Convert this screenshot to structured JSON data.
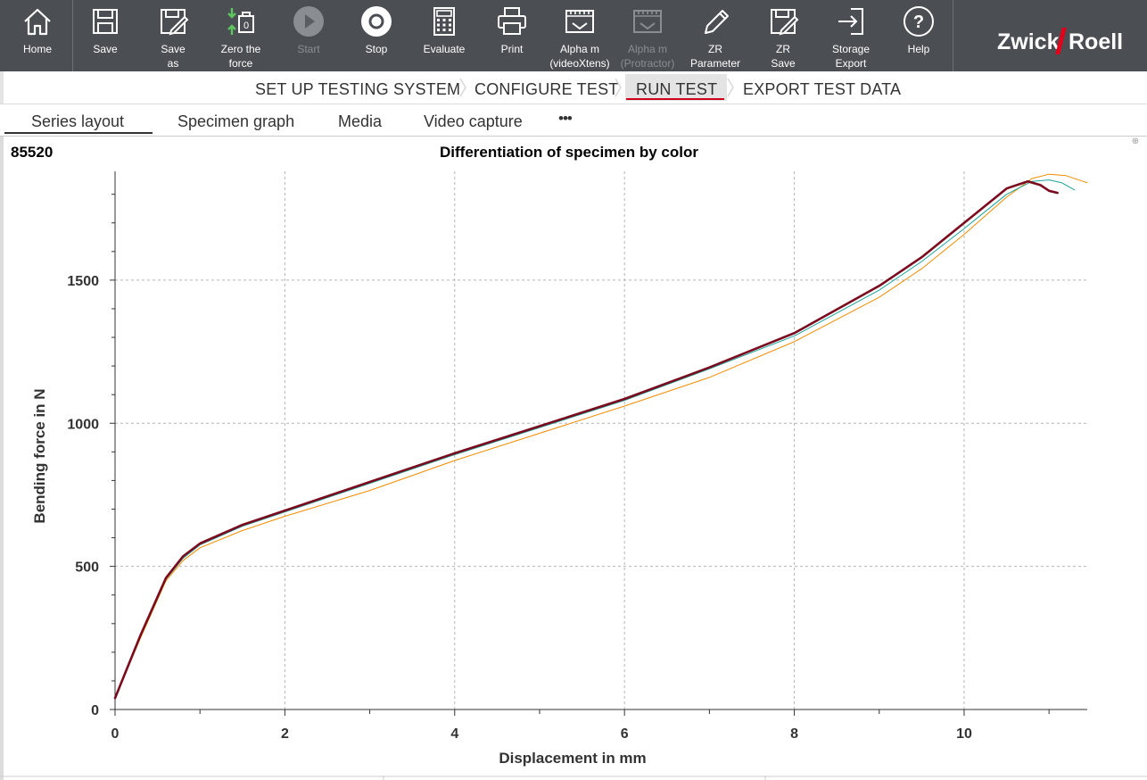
{
  "toolbar": {
    "buttons": [
      {
        "label": "Home",
        "icon": "home-icon",
        "enabled": true
      },
      {
        "label": "Save",
        "icon": "save-icon",
        "enabled": true
      },
      {
        "label": "Save\nas",
        "icon": "save-as-icon",
        "enabled": true
      },
      {
        "label": "Zero the\nforce",
        "icon": "zero-force-icon",
        "enabled": true
      },
      {
        "label": "Start",
        "icon": "play-icon",
        "enabled": false
      },
      {
        "label": "Stop",
        "icon": "stop-icon",
        "enabled": true
      },
      {
        "label": "Evaluate",
        "icon": "calculator-icon",
        "enabled": true
      },
      {
        "label": "Print",
        "icon": "printer-icon",
        "enabled": true
      },
      {
        "label": "Alpha m\n(videoXtens)",
        "icon": "ruler-icon",
        "enabled": true
      },
      {
        "label": "Alpha m\n(Protractor)",
        "icon": "ruler-icon",
        "enabled": false
      },
      {
        "label": "ZR\nParameter",
        "icon": "pencil-icon",
        "enabled": true
      },
      {
        "label": "ZR\nSave",
        "icon": "save-edit-icon",
        "enabled": true
      },
      {
        "label": "Storage\nExport",
        "icon": "export-icon",
        "enabled": true
      },
      {
        "label": "Help",
        "icon": "help-icon",
        "enabled": true
      }
    ],
    "logo_left": "Zwick",
    "logo_right": "Roell"
  },
  "nav": {
    "steps": [
      "SET UP TESTING SYSTEM",
      "CONFIGURE TEST",
      "RUN TEST",
      "EXPORT TEST DATA"
    ],
    "active": "RUN TEST"
  },
  "tabs": {
    "items": [
      "Series layout",
      "Specimen graph",
      "Media",
      "Video capture"
    ],
    "more": "•••",
    "active": "Series layout"
  },
  "chart": {
    "id_label": "85520",
    "zoom_symbol": "⊕"
  },
  "chart_data": {
    "type": "line",
    "title": "Differentiation of specimen by color",
    "xlabel": "Displacement in mm",
    "ylabel": "Bending force in N",
    "xlim": [
      0,
      11.45
    ],
    "ylim": [
      0,
      1880
    ],
    "xticks": [
      0,
      2,
      4,
      6,
      8,
      10
    ],
    "xtick_labels": [
      "0",
      "2",
      "4",
      "6",
      "8",
      "10"
    ],
    "yticks": [
      0,
      500,
      1000,
      1500
    ],
    "ytick_labels": [
      "0",
      "500",
      "1000",
      "1500"
    ],
    "grid": true,
    "legend": false,
    "series": [
      {
        "color": "#f08c00",
        "width": 1,
        "x": [
          0,
          0.3,
          0.6,
          0.8,
          1.0,
          1.5,
          2,
          3,
          4,
          5,
          6,
          7,
          8,
          9,
          9.5,
          10,
          10.5,
          10.8,
          11.0,
          11.2,
          11.45
        ],
        "y": [
          40,
          250,
          450,
          520,
          565,
          625,
          675,
          765,
          870,
          965,
          1060,
          1160,
          1285,
          1440,
          1540,
          1660,
          1790,
          1855,
          1870,
          1865,
          1840
        ]
      },
      {
        "color": "#1aa39a",
        "width": 1,
        "x": [
          0,
          0.3,
          0.6,
          0.8,
          1.0,
          1.5,
          2,
          3,
          4,
          5,
          6,
          7,
          8,
          9,
          9.5,
          10,
          10.5,
          10.8,
          11.0,
          11.15,
          11.3
        ],
        "y": [
          40,
          255,
          455,
          528,
          575,
          640,
          690,
          790,
          890,
          985,
          1080,
          1190,
          1305,
          1465,
          1565,
          1680,
          1800,
          1845,
          1850,
          1840,
          1815
        ]
      },
      {
        "color": "#7a0a1e",
        "width": 2.6,
        "x": [
          0,
          0.3,
          0.6,
          0.8,
          1.0,
          1.5,
          2,
          3,
          4,
          5,
          6,
          7,
          8,
          9,
          9.5,
          10,
          10.5,
          10.75,
          10.9,
          11.0,
          11.1
        ],
        "y": [
          40,
          260,
          460,
          535,
          580,
          645,
          695,
          795,
          895,
          990,
          1085,
          1195,
          1315,
          1480,
          1580,
          1700,
          1820,
          1845,
          1832,
          1812,
          1805
        ]
      }
    ]
  }
}
